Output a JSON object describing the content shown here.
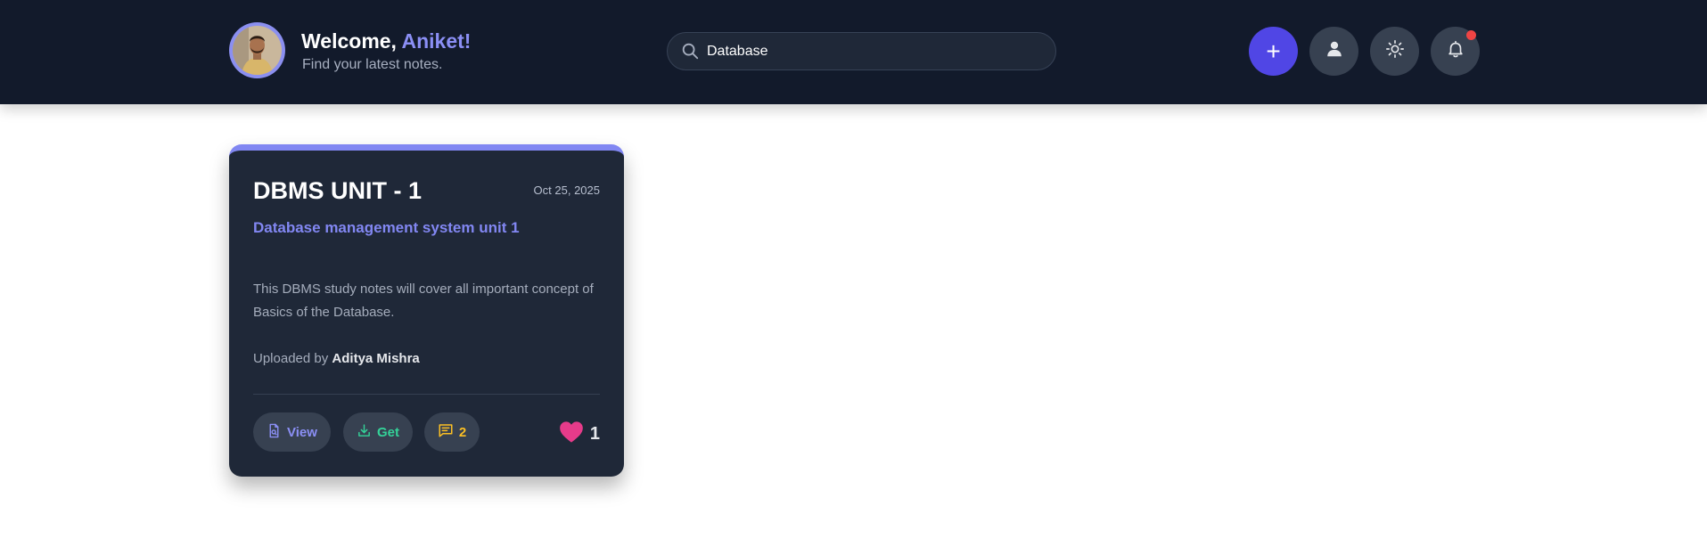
{
  "header": {
    "welcome_prefix": "Welcome, ",
    "user_name": "Aniket!",
    "subtitle": "Find your latest notes.",
    "search": {
      "value": "Database",
      "placeholder": ""
    },
    "actions": {
      "add_label": "+",
      "add_icon": "plus-icon",
      "profile_icon": "user-icon",
      "theme_icon": "sun-icon",
      "notifications_icon": "bell-icon",
      "has_notification": true
    }
  },
  "notes": [
    {
      "title": "DBMS UNIT - 1",
      "date": "Oct 25, 2025",
      "subtitle": "Database management system unit 1",
      "description": "This DBMS study notes will cover all important concept of Basics of the Database.",
      "uploaded_by_label": "Uploaded by",
      "uploader": "Aditya Mishra",
      "actions": {
        "view_label": "View",
        "get_label": "Get",
        "comments_count": "2"
      },
      "likes": "1"
    }
  ],
  "colors": {
    "header_bg": "#121a2b",
    "card_bg": "#1f2838",
    "accent": "#8187f2",
    "primary_button": "#5046e5",
    "view": "#8b8ff5",
    "get": "#34d399",
    "comments": "#fbbf24",
    "heart": "#e63b8a",
    "notification_dot": "#ef4444"
  }
}
